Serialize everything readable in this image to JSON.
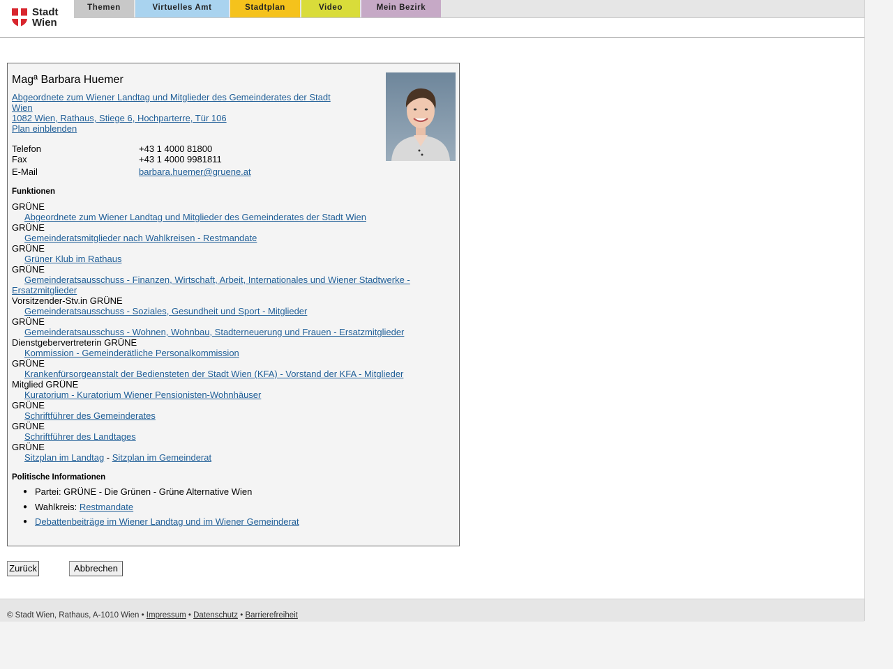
{
  "header": {
    "logo_text_line1": "Stadt",
    "logo_text_line2": "Wien",
    "nav": [
      "Themen",
      "Virtuelles Amt",
      "Stadtplan",
      "Video",
      "Mein Bezirk"
    ]
  },
  "person": {
    "name": "Magª Barbara Huemer",
    "role_line1": "Abgeordnete zum Wiener Landtag und Mitglieder des Gemeinderates der Stadt",
    "role_line2": "Wien ",
    "address": "1082 Wien, Rathaus, Stiege 6, Hochparterre, Tür 106",
    "plan_link": "Plan einblenden"
  },
  "contact": {
    "phone_label": "Telefon",
    "phone": "+43 1 4000 81800",
    "fax_label": "Fax",
    "fax": "+43 1 4000 9981811",
    "email_label": "E-Mail",
    "email": "barbara.huemer@gruene.at"
  },
  "functions_heading": "Funktionen",
  "functions": [
    {
      "prefix": "GRÜNE",
      "link": "Abgeordnete zum Wiener Landtag und Mitglieder des Gemeinderates der Stadt Wien"
    },
    {
      "prefix": "GRÜNE",
      "link": "Gemeinderatsmitglieder nach Wahlkreisen - Restmandate"
    },
    {
      "prefix": "GRÜNE",
      "link": "Grüner Klub im Rathaus"
    },
    {
      "prefix": "GRÜNE",
      "link": "Gemeinderatsausschuss - Finanzen, Wirtschaft, Arbeit, Internationales und Wiener Stadtwerke -",
      "link_cont": "Ersatzmitglieder"
    },
    {
      "prefix": "Vorsitzender-Stv.in GRÜNE",
      "link": "Gemeinderatsausschuss - Soziales, Gesundheit und Sport - Mitglieder"
    },
    {
      "prefix": "GRÜNE",
      "link": "Gemeinderatsausschuss - Wohnen, Wohnbau, Stadterneuerung und Frauen - Ersatzmitglieder"
    },
    {
      "prefix": "Dienstgebervertreterin GRÜNE",
      "link": "Kommission - Gemeinderätliche Personalkommission"
    },
    {
      "prefix": "GRÜNE",
      "link": "Krankenfürsorgeanstalt der Bediensteten der Stadt Wien (KFA) - Vorstand der KFA - Mitglieder"
    },
    {
      "prefix": "Mitglied GRÜNE",
      "link": "Kuratorium - Kuratorium Wiener Pensionisten-Wohnhäuser"
    },
    {
      "prefix": "GRÜNE",
      "link": "Schriftführer des Gemeinderates"
    },
    {
      "prefix": "GRÜNE",
      "link": "Schriftführer des Landtages"
    },
    {
      "prefix": "GRÜNE",
      "link": "Sitzplan im Landtag",
      "sep": " - ",
      "link2": "Sitzplan im Gemeinderat"
    }
  ],
  "political_heading": "Politische Informationen",
  "political": {
    "party": "Partei: GRÜNE - Die Grünen - Grüne Alternative Wien",
    "district_label": "Wahlkreis: ",
    "district_link": "Restmandate",
    "debates_link": "Debattenbeiträge im Wiener Landtag und im Wiener Gemeinderat"
  },
  "buttons": {
    "back": "Zurück",
    "cancel": "Abbrechen"
  },
  "footer": {
    "copyright": "© Stadt Wien, Rathaus, A-1010 Wien • ",
    "impressum": "Impressum",
    "sep1": " • ",
    "datenschutz": "Datenschutz",
    "sep2": " • ",
    "barrierefreiheit": "Barrierefreiheit"
  }
}
